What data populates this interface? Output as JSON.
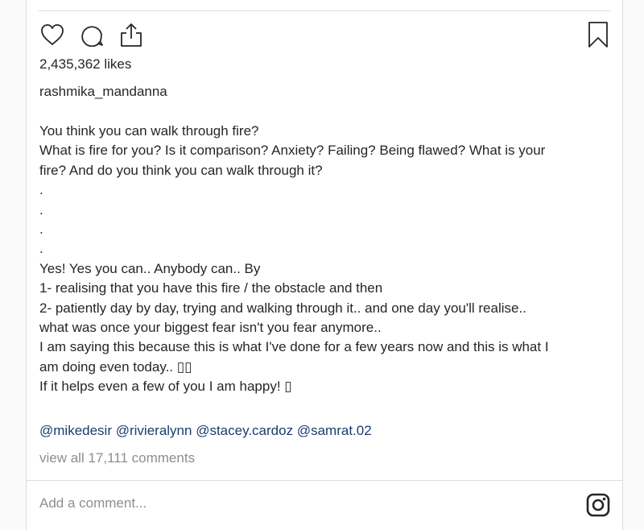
{
  "post": {
    "likes": "2,435,362 likes",
    "username": "rashmika_mandanna",
    "caption_lines": [
      "You think you can walk through fire?",
      "What is fire for you? Is it comparison? Anxiety? Failing? Being flawed? What is your",
      "fire? And do you think you can walk through it?",
      ".",
      ".",
      ".",
      ".",
      "Yes! Yes you can.. Anybody can.. By",
      "1- realising that you have this fire / the obstacle and then",
      "2- patiently day by day, trying and walking through it.. and one day you'll realise..",
      "what was once your biggest fear isn't you fear anymore..",
      "I am saying this because this is what I've done for a few years now and this is what I",
      "am doing even today.. ▯▯",
      "If it helps even a few of you I am happy! ▯"
    ],
    "mentions": [
      "@mikedesir",
      "@rivieralynn",
      "@stacey.cardoz",
      "@samrat.02"
    ],
    "view_comments": "view all 17,111 comments"
  },
  "comment_box": {
    "placeholder": "Add a comment..."
  },
  "icons": {
    "like": "heart-icon",
    "comment": "comment-bubble-icon",
    "share": "share-upload-icon",
    "save": "bookmark-icon",
    "instagram": "instagram-icon"
  },
  "colors": {
    "text": "#262626",
    "link": "#1a3d6e",
    "muted": "#8e8e8e",
    "border": "#dbdbdb"
  }
}
